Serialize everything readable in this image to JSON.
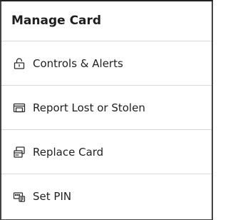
{
  "panel": {
    "title": "Manage Card"
  },
  "menu": {
    "items": [
      {
        "label": "Controls & Alerts",
        "icon": "lock-icon"
      },
      {
        "label": "Report Lost or Stolen",
        "icon": "card-report-icon"
      },
      {
        "label": "Replace Card",
        "icon": "replace-card-icon"
      },
      {
        "label": "Set PIN",
        "icon": "pin-keypad-icon"
      }
    ]
  }
}
